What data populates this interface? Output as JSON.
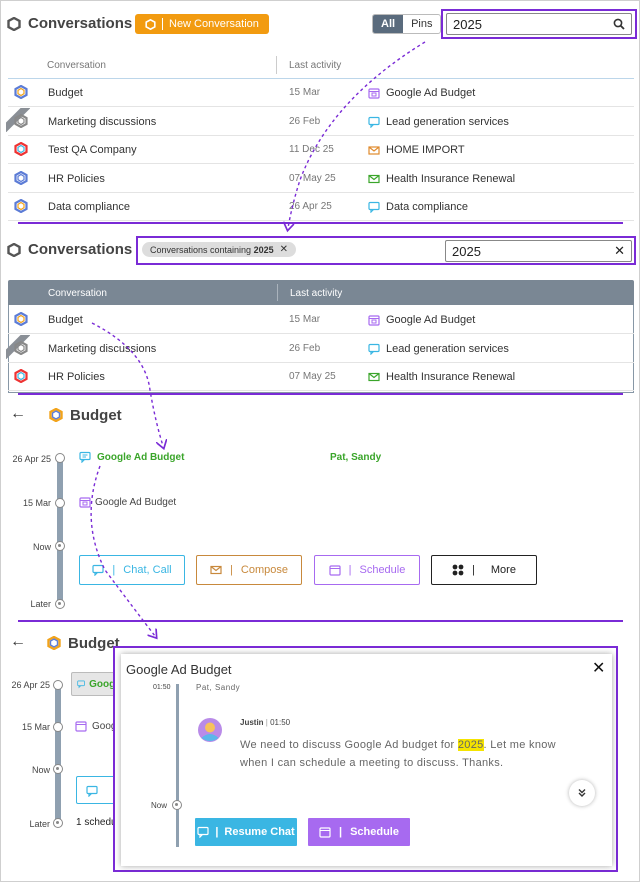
{
  "panel1": {
    "title": "Conversations",
    "new_button": "New Conversation",
    "filters": [
      "All",
      "Pins"
    ],
    "search_value": "2025",
    "columns": [
      "Conversation",
      "Last activity"
    ],
    "rows": [
      {
        "name": "Budget",
        "date": "15 Mar",
        "subject": "Google Ad Budget",
        "subject_icon": "calendar-icon"
      },
      {
        "name": "Marketing discussions",
        "date": "26 Feb",
        "subject": "Lead generation services",
        "subject_icon": "chat-icon"
      },
      {
        "name": "Test QA Company",
        "date": "11 Dec 25",
        "subject": "HOME IMPORT",
        "subject_icon": "mail-open-icon"
      },
      {
        "name": "HR Policies",
        "date": "07 May 25",
        "subject": "Health Insurance Renewal",
        "subject_icon": "mail-icon"
      },
      {
        "name": "Data compliance",
        "date": "26 Apr 25",
        "subject": "Data compliance",
        "subject_icon": "chat-icon"
      }
    ]
  },
  "panel2": {
    "title": "Conversations",
    "chip_prefix": "Conversations containing",
    "chip_term": "2025",
    "search_value": "2025",
    "columns": [
      "Conversation",
      "Last activity"
    ],
    "rows": [
      {
        "name": "Budget",
        "date": "15 Mar",
        "subject": "Google Ad Budget"
      },
      {
        "name": "Marketing discussions",
        "date": "26 Feb",
        "subject": "Lead generation services"
      },
      {
        "name": "HR Policies",
        "date": "07 May 25",
        "subject": "Health Insurance Renewal"
      }
    ]
  },
  "panel3": {
    "title": "Budget",
    "events": [
      {
        "date": "26 Apr 25",
        "subject": "Google Ad Budget",
        "participants": "Pat, Sandy"
      },
      {
        "date": "15 Mar",
        "subject": "Google Ad Budget"
      }
    ],
    "now_label": "Now",
    "later_label": "Later",
    "actions": [
      "Chat, Call",
      "Compose",
      "Schedule",
      "More"
    ]
  },
  "panel4": {
    "title": "Budget",
    "dates": [
      "26 Apr 25",
      "15 Mar"
    ],
    "now_label": "Now",
    "later_label": "Later",
    "event1_prefix": "Googl",
    "event2_prefix": "Goog",
    "later_text": "1 schedu",
    "popup": {
      "title": "Google Ad Budget",
      "time_top": "01:50",
      "participants": "Pat, Sandy",
      "sender": "Justin",
      "sent_time": "01:50",
      "message_before": "We need to discuss Google Ad budget for ",
      "message_highlight": "2025",
      "message_after": ". Let me know when I can schedule a meeting to discuss. Thanks.",
      "now_label": "Now",
      "resume_button": "Resume Chat",
      "schedule_button": "Schedule"
    }
  },
  "colors": {
    "accent_purple": "#7a2bd6",
    "orange": "#f29b10",
    "green": "#3aa52a",
    "blue": "#3ab6e3",
    "violet": "#a76af0"
  }
}
